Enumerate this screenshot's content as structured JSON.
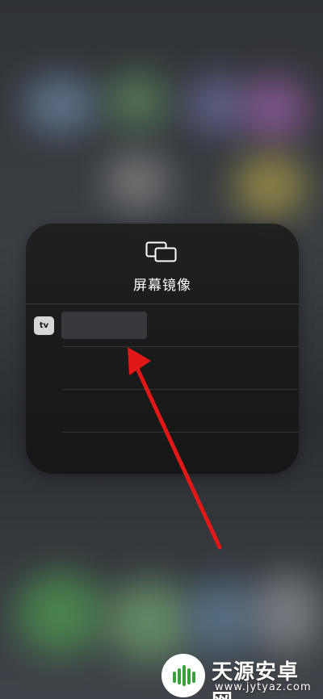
{
  "screen_mirroring": {
    "icon": "screen-mirroring-icon",
    "title": "屏幕镜像",
    "devices": [
      {
        "badge_text": "tv",
        "name": ""
      }
    ]
  },
  "watermark": {
    "name": "天源安卓网",
    "url": "www.jytyaz.com"
  },
  "colors": {
    "arrow": "#e01818",
    "panel": "#1c1e1e",
    "badge": "#d6d6d6"
  }
}
